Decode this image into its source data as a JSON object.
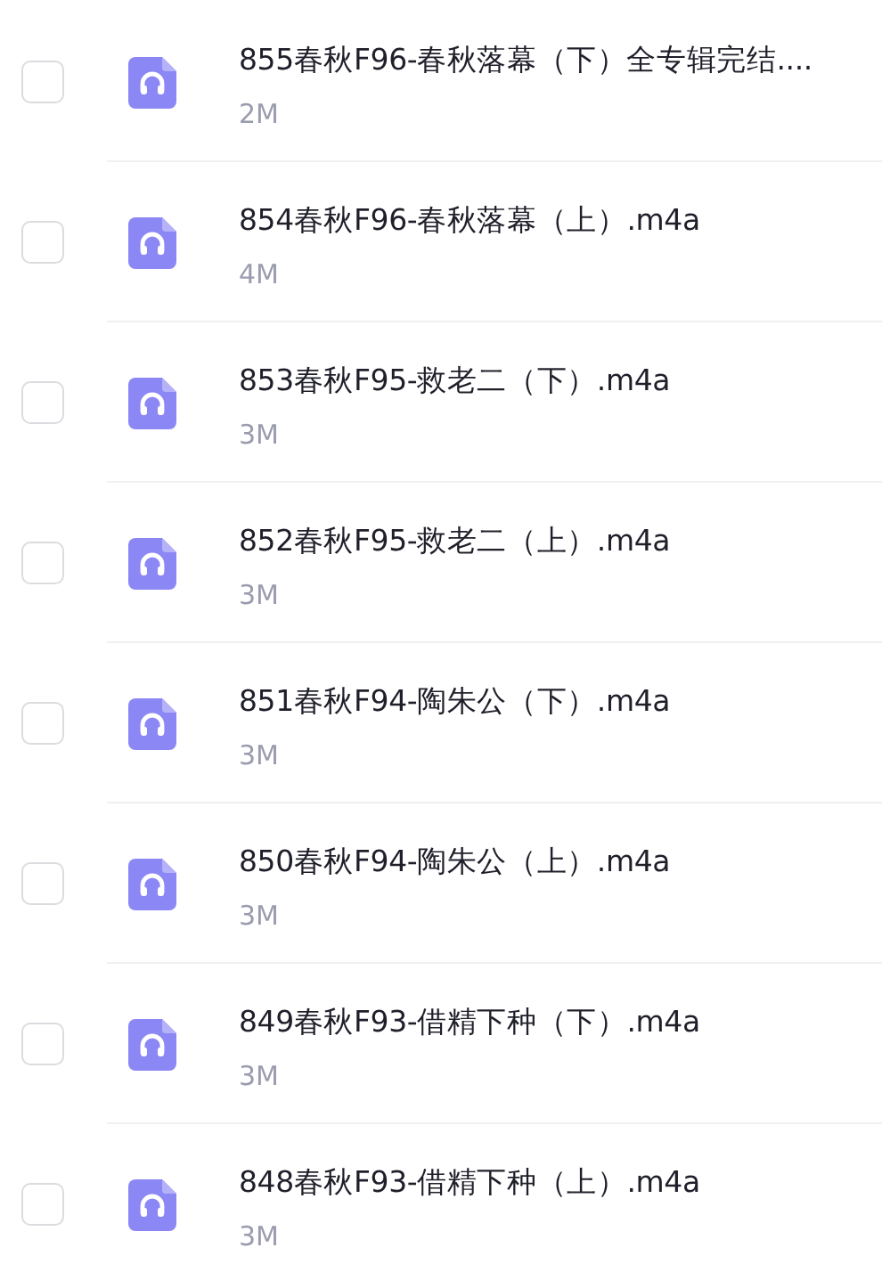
{
  "files": [
    {
      "name": "855春秋F96-春秋落幕（下）全专辑完结....",
      "size": "2M",
      "checked": false
    },
    {
      "name": "854春秋F96-春秋落幕（上）.m4a",
      "size": "4M",
      "checked": false
    },
    {
      "name": "853春秋F95-救老二（下）.m4a",
      "size": "3M",
      "checked": false
    },
    {
      "name": "852春秋F95-救老二（上）.m4a",
      "size": "3M",
      "checked": false
    },
    {
      "name": "851春秋F94-陶朱公（下）.m4a",
      "size": "3M",
      "checked": false
    },
    {
      "name": "850春秋F94-陶朱公（上）.m4a",
      "size": "3M",
      "checked": false
    },
    {
      "name": "849春秋F93-借精下种（下）.m4a",
      "size": "3M",
      "checked": false
    },
    {
      "name": "848春秋F93-借精下种（上）.m4a",
      "size": "3M",
      "checked": false
    }
  ]
}
